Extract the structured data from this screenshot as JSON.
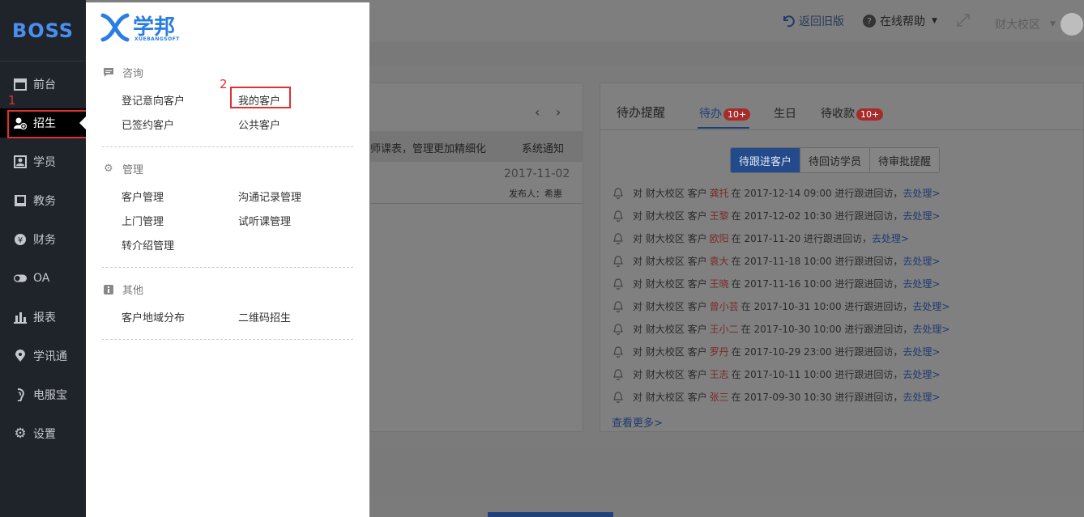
{
  "sidebar": {
    "logo": "BOSS",
    "items": [
      {
        "label": "前台",
        "icon": "calendar-icon"
      },
      {
        "label": "招生",
        "icon": "add-user-icon"
      },
      {
        "label": "学员",
        "icon": "id-card-icon"
      },
      {
        "label": "教务",
        "icon": "book-icon"
      },
      {
        "label": "财务",
        "icon": "yen-icon"
      },
      {
        "label": "OA",
        "icon": "toggle-icon"
      },
      {
        "label": "报表",
        "icon": "bar-chart-icon"
      },
      {
        "label": "学讯通",
        "icon": "location-pin-icon"
      },
      {
        "label": "电服宝",
        "icon": "phone-ear-icon"
      },
      {
        "label": "设置",
        "icon": "gear-icon"
      }
    ]
  },
  "annotations": {
    "step1": "1",
    "step2": "2"
  },
  "topbar": {
    "back_old": "返回旧版",
    "help": "在线帮助",
    "campus": "财大校区"
  },
  "menu": {
    "logo_cn": "学邦",
    "logo_en": "XUEBANGSOFT",
    "sections": {
      "consult": {
        "title": "咨询",
        "items": [
          "登记意向客户",
          "我的客户",
          "已签约客户",
          "公共客户"
        ]
      },
      "manage": {
        "title": "管理",
        "items": [
          "客户管理",
          "沟通记录管理",
          "上门管理",
          "试听课管理",
          "转介绍管理"
        ]
      },
      "other": {
        "title": "其他",
        "items": [
          "客户地域分布",
          "二维码招生"
        ]
      }
    }
  },
  "news": {
    "headline": "师课表，管理更加精细化",
    "category": "系统通知",
    "date": "2017-11-02",
    "publisher": "发布人：希惠"
  },
  "reminder": {
    "title": "待办提醒",
    "tabs": [
      {
        "label": "待办",
        "badge": "10+"
      },
      {
        "label": "生日",
        "badge": ""
      },
      {
        "label": "待收款",
        "badge": "10+"
      }
    ],
    "segments": [
      "待跟进客户",
      "待回访学员",
      "待审批提醒"
    ],
    "rows": [
      {
        "pre": "对 财大校区 客户",
        "name": "龚托",
        "post": "在 2017-12-14 09:00 进行跟进回访，",
        "link": "去处理>"
      },
      {
        "pre": "对 财大校区 客户",
        "name": "王黎",
        "post": "在 2017-12-02 10:30 进行跟进回访，",
        "link": "去处理>"
      },
      {
        "pre": "对 财大校区 客户",
        "name": "欧阳",
        "post": "在 2017-11-20 进行跟进回访，",
        "link": "去处理>"
      },
      {
        "pre": "对 财大校区 客户",
        "name": "袁大",
        "post": "在 2017-11-18 10:00 进行跟进回访，",
        "link": "去处理>"
      },
      {
        "pre": "对 财大校区 客户",
        "name": "王晓",
        "post": "在 2017-11-16 10:00 进行跟进回访，",
        "link": "去处理>"
      },
      {
        "pre": "对 财大校区 客户",
        "name": "曾小芸",
        "post": "在 2017-10-31 10:00 进行跟进回访，",
        "link": "去处理>"
      },
      {
        "pre": "对 财大校区 客户",
        "name": "王小二",
        "post": "在 2017-10-30 10:00 进行跟进回访，",
        "link": "去处理>"
      },
      {
        "pre": "对 财大校区 客户",
        "name": "罗丹",
        "post": "在 2017-10-29 23:00 进行跟进回访，",
        "link": "去处理>"
      },
      {
        "pre": "对 财大校区 客户",
        "name": "王志",
        "post": "在 2017-10-11 10:00 进行跟进回访，",
        "link": "去处理>"
      },
      {
        "pre": "对 财大校区 客户",
        "name": "张三",
        "post": "在 2017-09-30 10:30 进行跟进回访，",
        "link": "去处理>"
      }
    ],
    "more": "查看更多>"
  }
}
